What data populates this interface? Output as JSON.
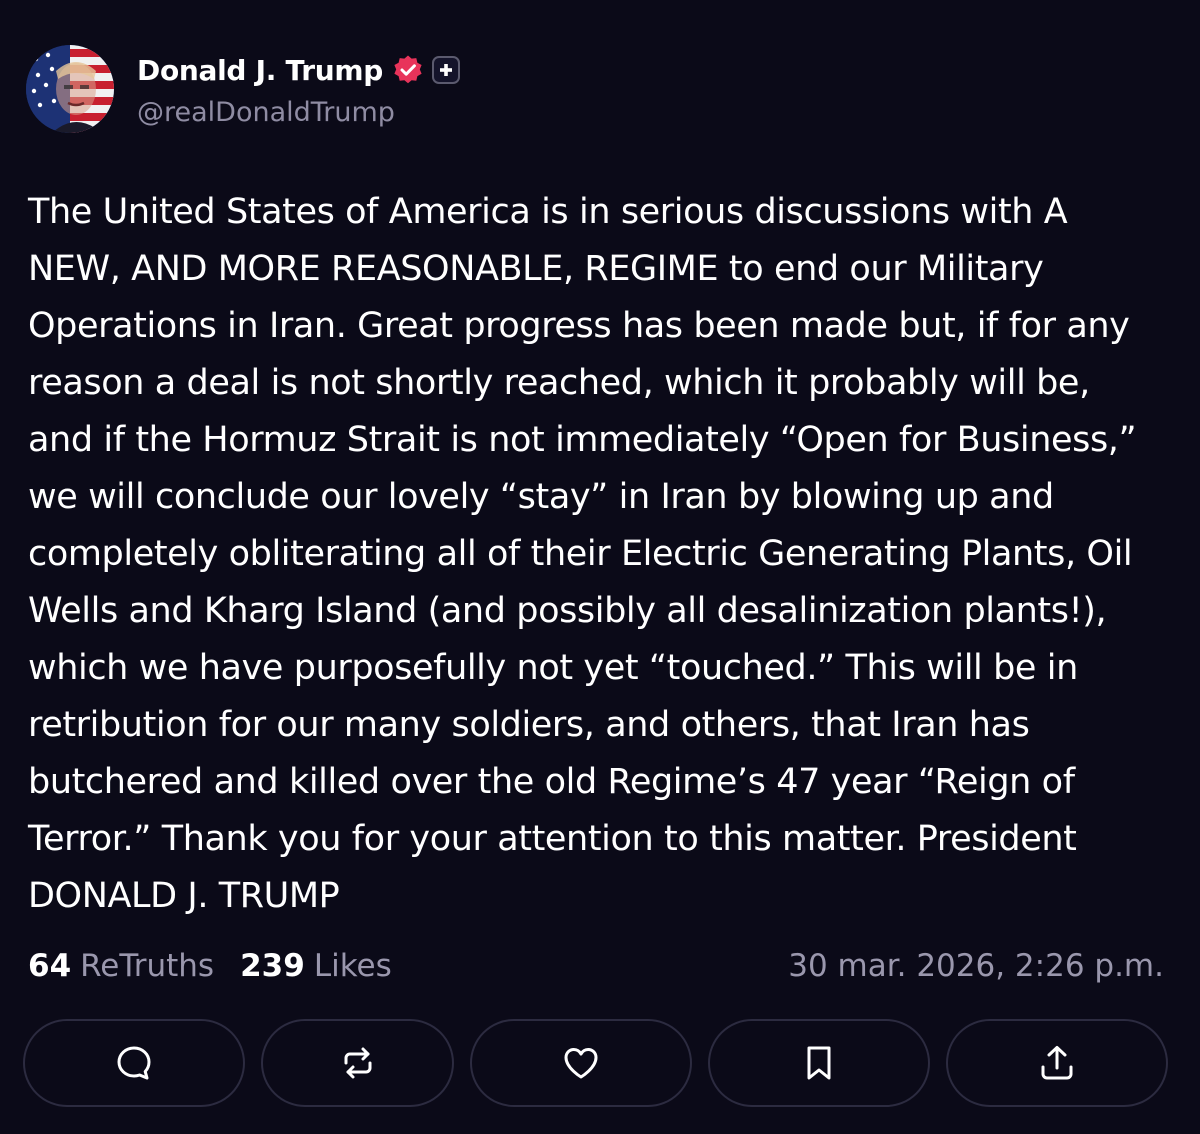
{
  "author": {
    "display_name": "Donald J. Trump",
    "handle": "@realDonaldTrump",
    "avatar_icon": "flag-portrait-avatar",
    "verified_icon": "verified-badge-icon",
    "plus_icon": "plus-badge-icon"
  },
  "post": {
    "text": "The United States of America is in serious discussions with A\nNEW, AND MORE REASONABLE, REGIME to end our Military\nOperations in Iran. Great progress has been made but, if for any\nreason a deal is not shortly reached, which it probably will be,\nand if the Hormuz Strait is not immediately “Open for Business,”\nwe will conclude our lovely “stay” in Iran by blowing up and\ncompletely obliterating all of their Electric Generating Plants, Oil\nWells and Kharg Island (and possibly all desalinization plants!),\nwhich we have purposefully not yet “touched.” This will be in\nretribution for our many soldiers, and others, that Iran has\nbutchered and killed over the old Regime’s 47 year “Reign of\nTerror.” Thank you for your attention to this matter. President\nDONALD J. TRUMP"
  },
  "stats": {
    "retruths_count": "64",
    "retruths_label": "ReTruths",
    "likes_count": "239",
    "likes_label": "Likes",
    "timestamp": "30 mar. 2026, 2:26 p.m."
  },
  "actions": [
    {
      "icon": "comment-icon"
    },
    {
      "icon": "retruth-icon"
    },
    {
      "icon": "heart-icon"
    },
    {
      "icon": "bookmark-icon"
    },
    {
      "icon": "share-icon"
    }
  ],
  "colors": {
    "background": "#0b0a18",
    "text": "#ffffff",
    "muted": "#9a97ad",
    "verified": "#e8335a",
    "button_border": "#2c2b40"
  }
}
